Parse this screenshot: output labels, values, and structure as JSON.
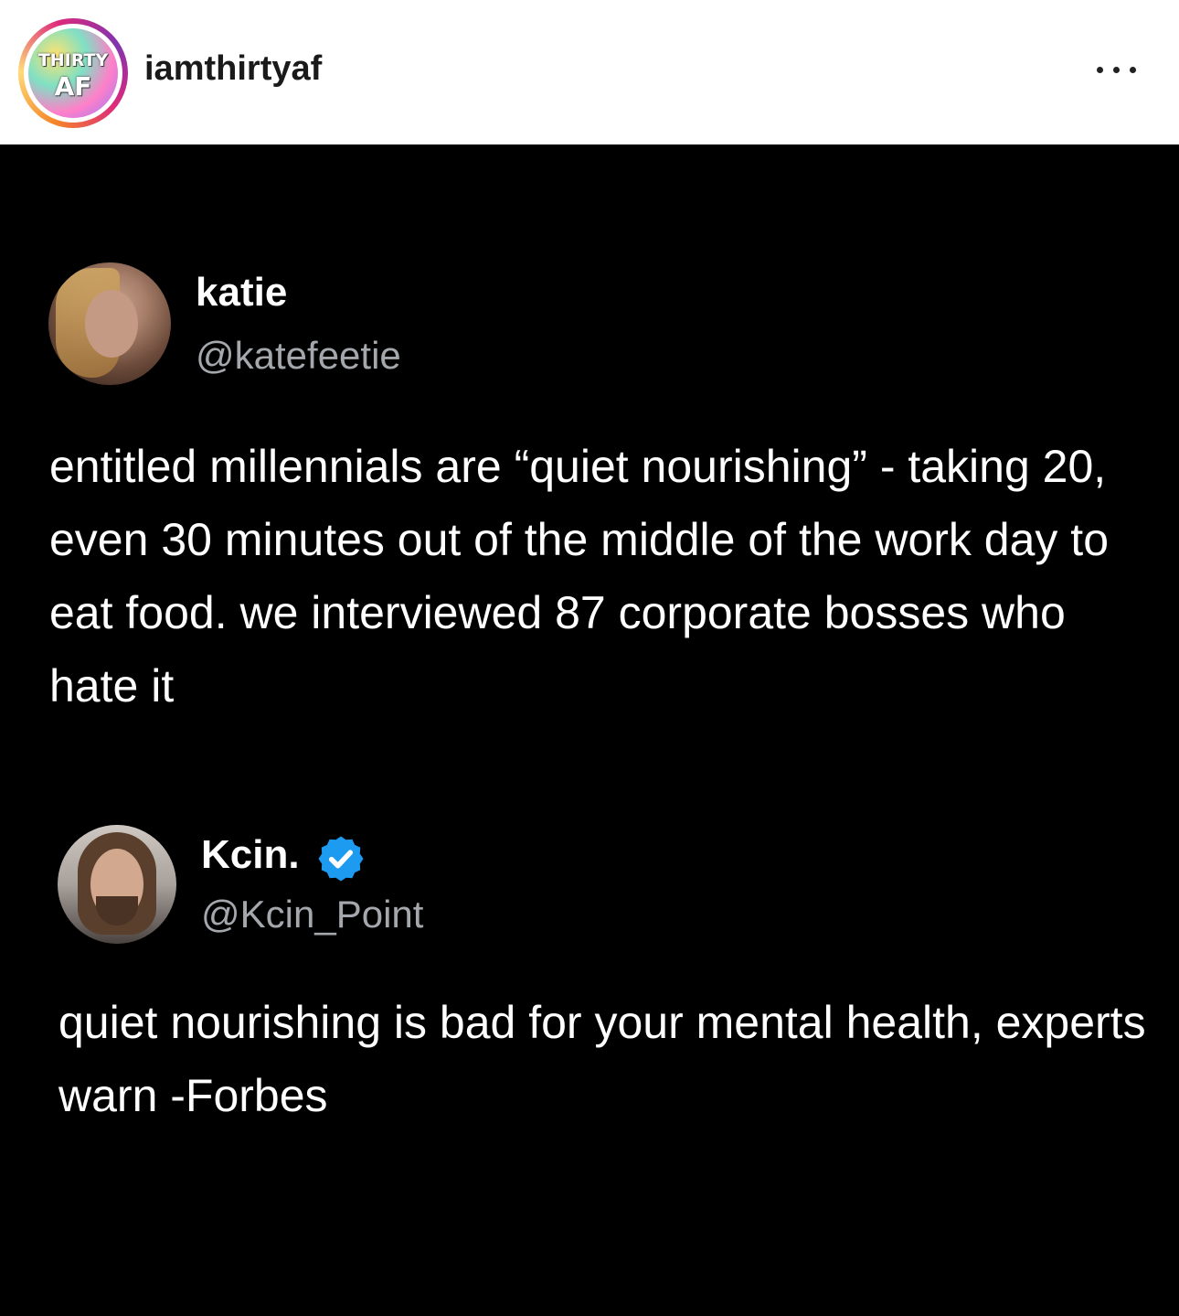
{
  "post_header": {
    "username": "iamthirtyaf",
    "avatar_logo_line1": "THIRTY",
    "avatar_logo_line2": "AF",
    "more_icon": "more-horizontal-icon"
  },
  "tweets": [
    {
      "name": "katie",
      "handle": "@katefeetie",
      "verified": false,
      "text": "entitled millennials are “quiet nourishing” - taking 20, even 30 minutes out of the middle of the work day to eat food. we interviewed 87 corporate bosses who hate it"
    },
    {
      "name": "Kcin.",
      "handle": "@Kcin_Point",
      "verified": true,
      "verified_icon": "verified-badge-icon",
      "text": "quiet nourishing is bad for your mental health, experts warn -Forbes"
    }
  ],
  "colors": {
    "header_bg": "#ffffff",
    "post_bg": "#000000",
    "handle_gray": "#a4a8ad",
    "verified_blue": "#1d9bf0"
  }
}
